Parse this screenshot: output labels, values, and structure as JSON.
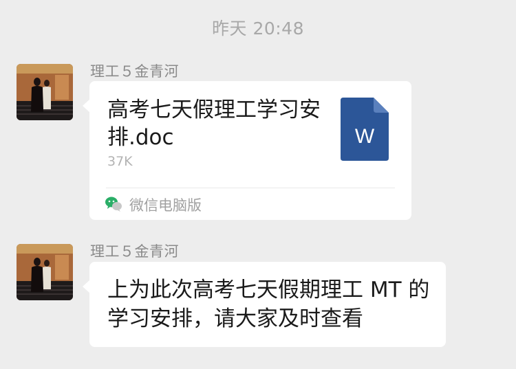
{
  "chat": {
    "timestamp": "昨天 20:48",
    "messages": [
      {
        "sender": "理工５金青河",
        "type": "file",
        "file_name": "高考七天假理工学习安排.doc",
        "file_size": "37K",
        "file_icon_letter": "W",
        "file_icon": "word-document-icon",
        "source_label": "微信电脑版",
        "source_icon": "wechat-icon"
      },
      {
        "sender": "理工５金青河",
        "type": "text",
        "text": "上为此次高考七天假期理工 MT 的学习安排，请大家及时查看"
      }
    ]
  },
  "colors": {
    "background": "#ededed",
    "bubble": "#ffffff",
    "word_blue": "#2c5698",
    "wechat_green": "#2aae67"
  }
}
